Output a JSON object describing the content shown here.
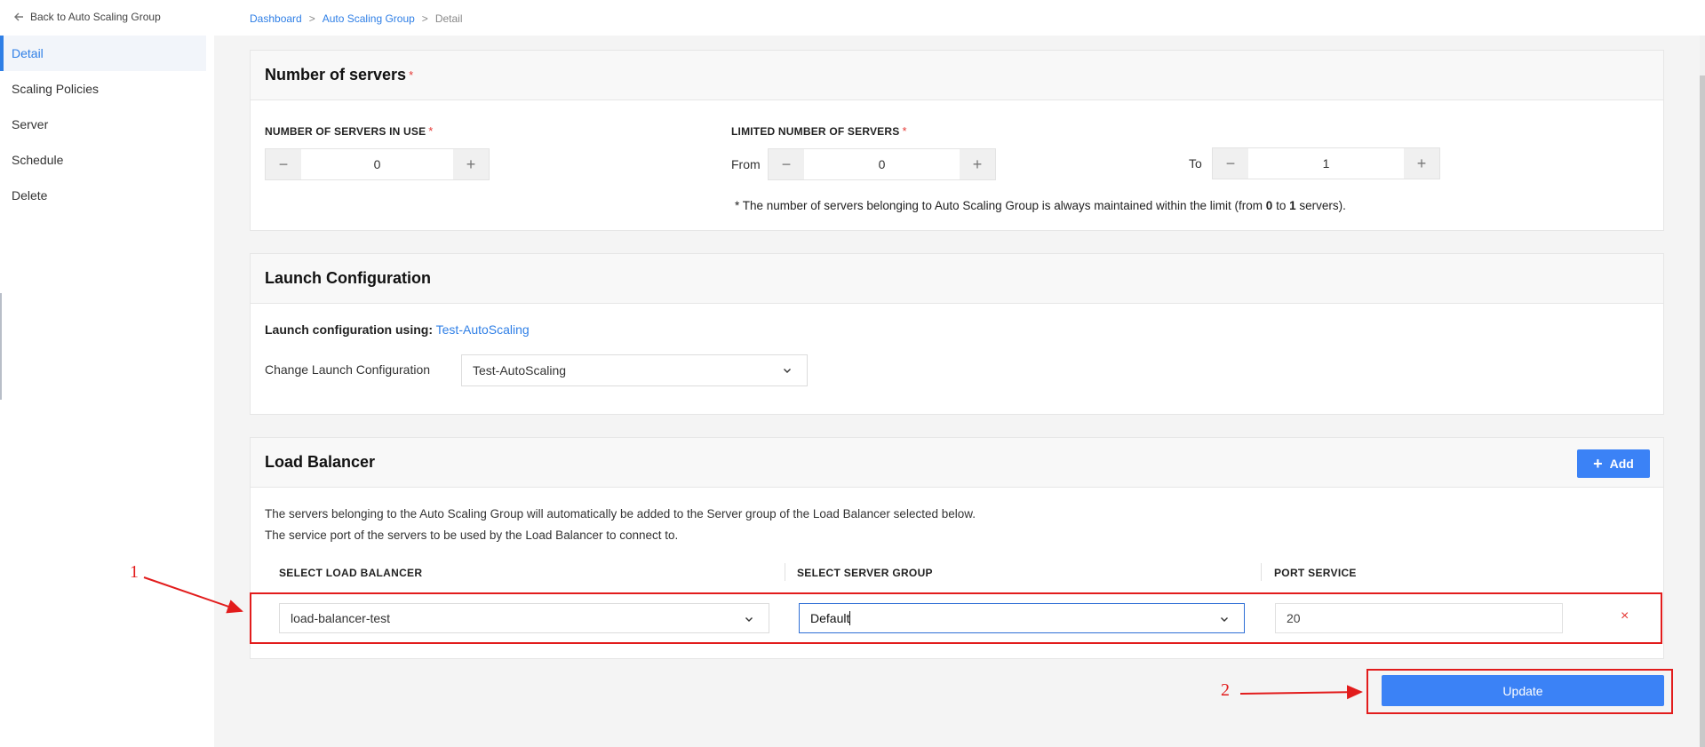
{
  "header": {
    "back_label": "Back to Auto Scaling Group",
    "breadcrumb": [
      "Dashboard",
      "Auto Scaling Group",
      "Detail"
    ],
    "breadcrumb_sep": ">"
  },
  "sidebar": {
    "items": [
      {
        "label": "Detail",
        "active": true
      },
      {
        "label": "Scaling Policies"
      },
      {
        "label": "Server"
      },
      {
        "label": "Schedule"
      },
      {
        "label": "Delete"
      }
    ]
  },
  "servers_card": {
    "title": "Number of servers",
    "required_mark": "*",
    "in_use_label": "NUMBER OF SERVERS IN USE",
    "in_use_value": "0",
    "limited_label": "LIMITED NUMBER OF SERVERS",
    "from_label": "From",
    "from_value": "0",
    "to_label": "To",
    "to_value": "1",
    "note_pre": "* The number of servers belonging to Auto Scaling Group is always maintained within the limit (from ",
    "note_from": "0",
    "note_mid": " to ",
    "note_to": "1",
    "note_post": " servers)."
  },
  "launch_card": {
    "title": "Launch Configuration",
    "using_label": "Launch configuration using:",
    "using_link": "Test-AutoScaling",
    "change_label": "Change Launch Configuration",
    "change_value": "Test-AutoScaling"
  },
  "lb_card": {
    "title": "Load Balancer",
    "add_label": "Add",
    "desc_line1": "The servers belonging to the Auto Scaling Group will automatically be added to the Server group of the Load Balancer selected below.",
    "desc_line2": "The service port of the servers to be used by the Load Balancer to connect to.",
    "col_lb": "SELECT LOAD BALANCER",
    "col_group": "SELECT SERVER GROUP",
    "col_port": "PORT SERVICE",
    "row": {
      "load_balancer": "load-balancer-test",
      "server_group": "Default",
      "port": "20",
      "remove_glyph": "×"
    }
  },
  "update_label": "Update",
  "annotations": {
    "one": "1",
    "two": "2",
    "color": "#e21c1c"
  },
  "colors": {
    "accent": "#3b82f6",
    "link": "#2f7fe6",
    "required": "#e53935"
  }
}
